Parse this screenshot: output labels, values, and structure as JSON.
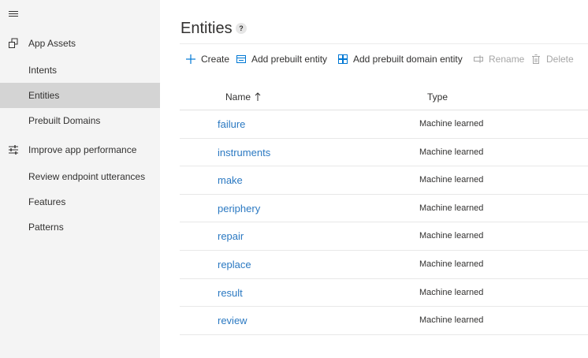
{
  "sidebar": {
    "groups": [
      {
        "label": "App Assets",
        "icon": "app-assets-icon",
        "items": [
          {
            "label": "Intents",
            "selected": false
          },
          {
            "label": "Entities",
            "selected": true
          },
          {
            "label": "Prebuilt Domains",
            "selected": false
          }
        ]
      },
      {
        "label": "Improve app performance",
        "icon": "sliders-icon",
        "items": [
          {
            "label": "Review endpoint utterances",
            "selected": false
          },
          {
            "label": "Features",
            "selected": false
          },
          {
            "label": "Patterns",
            "selected": false
          }
        ]
      }
    ]
  },
  "header": {
    "title": "Entities",
    "help": "?"
  },
  "commands": {
    "create": "Create",
    "add_prebuilt": "Add prebuilt entity",
    "add_prebuilt_domain": "Add prebuilt domain entity",
    "rename": "Rename",
    "delete": "Delete"
  },
  "table": {
    "columns": {
      "name": "Name",
      "type": "Type"
    },
    "rows": [
      {
        "name": "failure",
        "type": "Machine learned"
      },
      {
        "name": "instruments",
        "type": "Machine learned"
      },
      {
        "name": "make",
        "type": "Machine learned"
      },
      {
        "name": "periphery",
        "type": "Machine learned"
      },
      {
        "name": "repair",
        "type": "Machine learned"
      },
      {
        "name": "replace",
        "type": "Machine learned"
      },
      {
        "name": "result",
        "type": "Machine learned"
      },
      {
        "name": "review",
        "type": "Machine learned"
      }
    ]
  },
  "colors": {
    "accent": "#0078d4",
    "link": "#2b79c2",
    "sidebar_bg": "#f4f4f4",
    "selected_bg": "#d4d4d4",
    "disabled": "#a6a6a6"
  }
}
